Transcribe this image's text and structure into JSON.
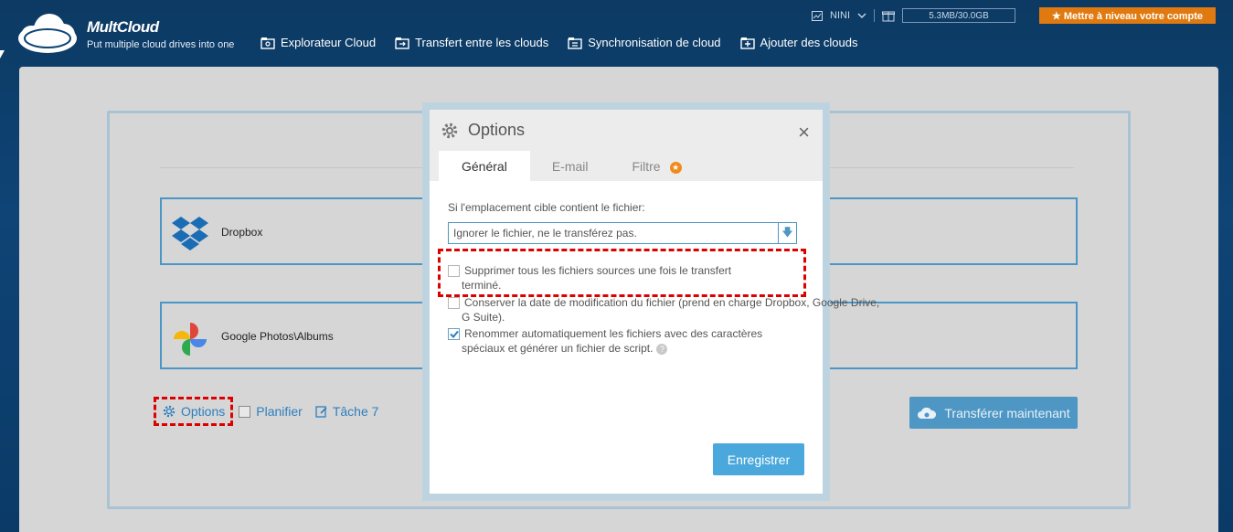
{
  "header": {
    "logo_name": "MultCloud",
    "tagline": "Put multiple cloud drives into one",
    "nav": [
      {
        "label": "Explorateur Cloud",
        "icon": "explorer-icon"
      },
      {
        "label": "Transfert entre les clouds",
        "icon": "transfer-icon"
      },
      {
        "label": "Synchronisation de cloud",
        "icon": "sync-icon"
      },
      {
        "label": "Ajouter des clouds",
        "icon": "add-cloud-icon"
      }
    ],
    "user": "NINI",
    "quota": "5.3MB/30.0GB",
    "upgrade": "★ Mettre à niveau votre compte"
  },
  "main": {
    "source_cloud": "Dropbox",
    "target_cloud": "Google Photos\\Albums",
    "options_label": "Options",
    "schedule_label": "Planifier",
    "task_label": "Tâche 7",
    "transfer_label": "Transférer maintenant"
  },
  "modal": {
    "title": "Options",
    "close": "×",
    "tabs": [
      "Général",
      "E-mail",
      "Filtre"
    ],
    "tab_badge": "★",
    "label": "Si l'emplacement cible contient le fichier:",
    "select_value": "Ignorer le fichier, ne le transférez pas.",
    "select_arrow": "🡇",
    "option1_line1": "Supprimer tous les fichiers sources une fois le transfert",
    "option1_line2": "terminé.",
    "option2_line1": "Conserver la date de modification du fichier (prend en charge Dropbox, Google Drive,",
    "option2_line2": "G Suite).",
    "option3_line1": "Renommer automatiquement les fichiers avec des caractères",
    "option3_line2": "spéciaux et générer un fichier de script.",
    "help": "?",
    "save": "Enregistrer"
  },
  "colors": {
    "accent": "#4e96c4",
    "upgrade": "#e07a10",
    "highlight": "#dd0000"
  }
}
